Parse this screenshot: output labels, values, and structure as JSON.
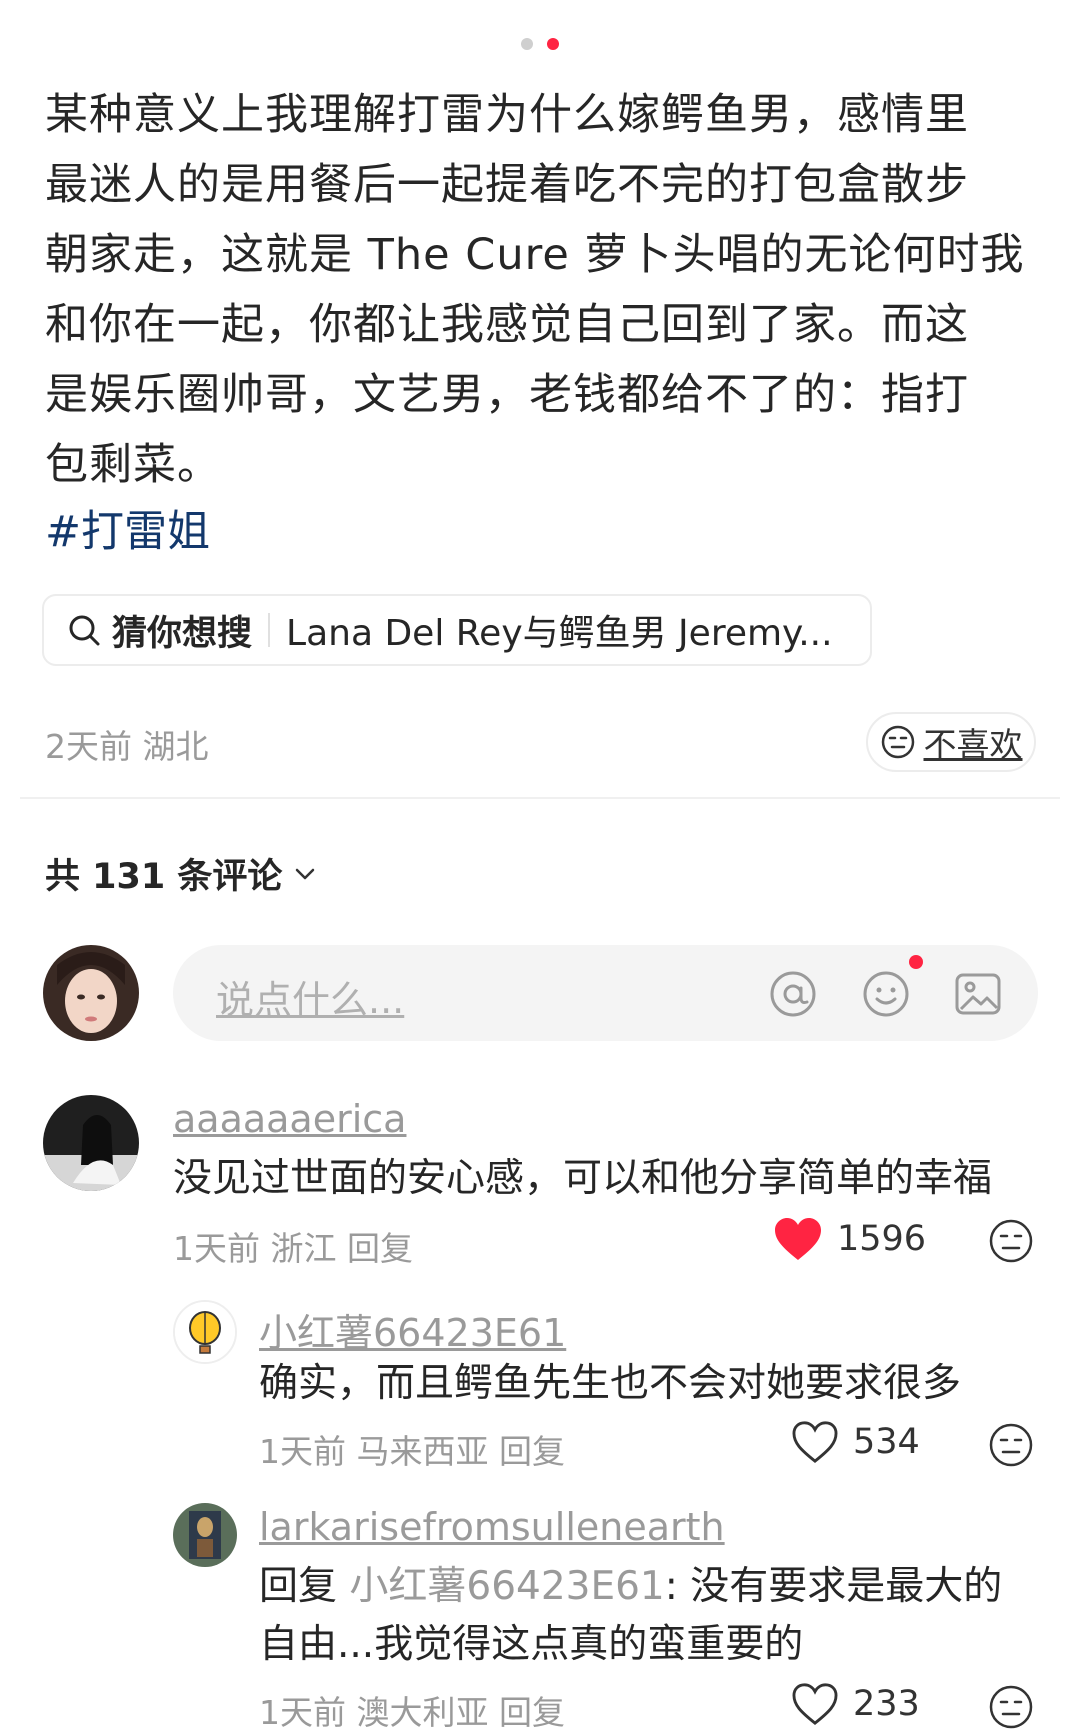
{
  "post": {
    "lines": [
      "某种意义上我理解打雷为什么嫁鳄鱼男，感情里",
      "最迷人的是用餐后一起提着吃不完的打包盒散步",
      "朝家走，这就是 The Cure 萝卜头唱的无论何时我",
      "和你在一起，你都让我感觉自己回到了家。而这",
      "是娱乐圈帅哥，文艺男，老钱都给不了的：指打",
      "包剩菜。"
    ],
    "hashtag": "#打雷姐",
    "search_prefix": "猜你想搜",
    "search_query": "Lana Del Rey与鳄鱼男 Jeremy...",
    "meta": "2天前 湖北",
    "dislike_label": "不喜欢"
  },
  "comments_header": "共 131 条评论",
  "input": {
    "placeholder": "说点什么..."
  },
  "comments": [
    {
      "user": "aaaaaaerica",
      "text": "没见过世面的安心感，可以和他分享简单的幸福",
      "meta": "1天前 浙江 回复",
      "likes": "1596"
    },
    {
      "user": "小红薯66423E61",
      "text": "确实，而且鳄鱼先生也不会对她要求很多",
      "meta": "1天前 马来西亚 回复",
      "likes": "534"
    },
    {
      "user": "larkarisefromsullenearth",
      "reply_prefix": "回复 ",
      "reply_to": "小红薯66423E61",
      "text_line1": ": 没有要求是最大的",
      "text_line2": "自由...我觉得这点真的蛮重要的",
      "meta": "1天前 澳大利亚 回复",
      "likes": "233"
    }
  ],
  "colors": {
    "accent": "#ff2442",
    "hashtag": "#13386c",
    "muted": "#9a9a9a"
  }
}
